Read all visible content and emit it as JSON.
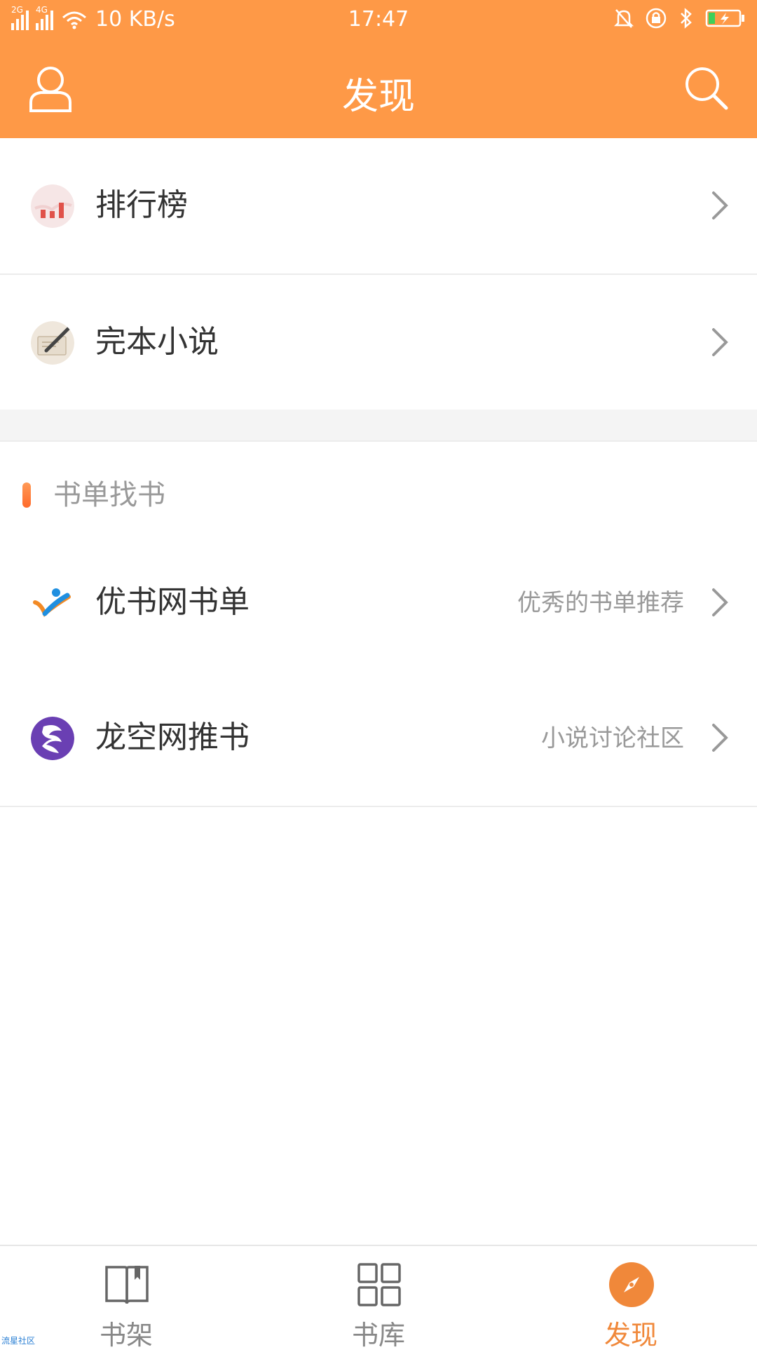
{
  "status_bar": {
    "net_left": "2G",
    "net_right": "4G",
    "speed": "10 KB/s",
    "time": "17:47",
    "icons": [
      "bell-off-icon",
      "lock-rotation-icon",
      "bluetooth-icon",
      "battery-icon"
    ]
  },
  "header": {
    "title": "发现",
    "left_icon": "user-icon",
    "right_icon": "search-icon"
  },
  "list_top": [
    {
      "label": "排行榜",
      "icon": "ranking-chart-icon"
    },
    {
      "label": "完本小说",
      "icon": "completed-novel-icon"
    }
  ],
  "section": {
    "title": "书单找书"
  },
  "list_bottom": [
    {
      "label": "优书网书单",
      "sub": "优秀的书单推荐",
      "icon": "youshu-logo-icon"
    },
    {
      "label": "龙空网推书",
      "sub": "小说讨论社区",
      "icon": "lkong-dragon-icon"
    }
  ],
  "bottom_nav": {
    "tabs": [
      {
        "label": "书架",
        "icon": "bookshelf-icon",
        "active": false
      },
      {
        "label": "书库",
        "icon": "library-grid-icon",
        "active": false
      },
      {
        "label": "发现",
        "icon": "compass-icon",
        "active": true
      }
    ]
  },
  "watermark": "流星社区",
  "colors": {
    "accent": "#FE9947",
    "active_tab": "#F0883A"
  }
}
